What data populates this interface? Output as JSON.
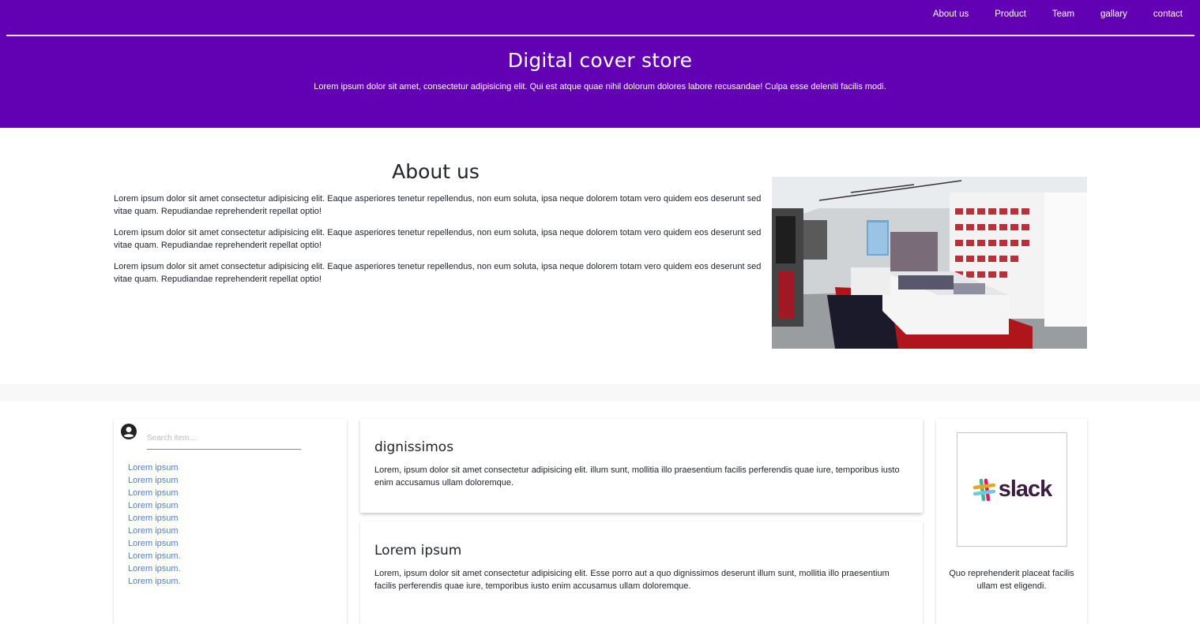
{
  "nav": {
    "items": [
      "About us",
      "Product",
      "Team",
      "gallary",
      "contact"
    ]
  },
  "hero": {
    "title": "Digital cover store",
    "subtitle": "Lorem ipsum dolor sit amet, consectetur adipisicing elit. Qui est atque quae nihil dolorum dolores labore recusandae! Culpa esse deleniti facilis modi."
  },
  "about": {
    "title": "About us",
    "paragraphs": [
      "Lorem ipsum dolor sit amet consectetur adipisicing elit. Eaque asperiores tenetur repellendus, non eum soluta, ipsa neque dolorem totam vero quidem eos deserunt sed vitae quam. Repudiandae reprehenderit repellat optio!",
      "Lorem ipsum dolor sit amet consectetur adipisicing elit. Eaque asperiores tenetur repellendus, non eum soluta, ipsa neque dolorem totam vero quidem eos deserunt sed vitae quam. Repudiandae reprehenderit repellat optio!",
      "Lorem ipsum dolor sit amet consectetur adipisicing elit. Eaque asperiores tenetur repellendus, non eum soluta, ipsa neque dolorem totam vero quidem eos deserunt sed vitae quam. Repudiandae reprehenderit repellat optio!"
    ]
  },
  "sidebar": {
    "search_placeholder": "Search item....",
    "links": [
      "Lorem ipsum",
      "Lorem ipsum",
      "Lorem ipsum",
      "Lorem ipsum",
      "Lorem ipsum",
      "Lorem ipsum",
      "Lorem ipsum",
      "Lorem ipsum.",
      "Lorem ipsum.",
      "Lorem ipsum."
    ]
  },
  "posts": [
    {
      "title": "dignissimos",
      "body": "Lorem, ipsum dolor sit amet consectetur adipisicing elit. illum sunt, mollitia illo praesentium facilis perferendis quae iure, temporibus iusto enim accusamus ullam doloremque."
    },
    {
      "title": "Lorem ipsum",
      "body": "Lorem, ipsum dolor sit amet consectetur adipisicing elit. Esse porro aut a quo dignissimos deserunt illum sunt, mollitia illo praesentium facilis perferendis quae iure, temporibus iusto enim accusamus ullam doloremque."
    }
  ],
  "logo_card": {
    "logo_text": "slack",
    "caption": "Quo reprehenderit placeat facilis ullam est eligendi."
  },
  "colors": {
    "header_bg": "#6200b3",
    "link": "#4a7fd4"
  },
  "icons": {
    "user": "user-circle-icon",
    "logo": "slack-logo-icon",
    "store": "store-interior-image"
  }
}
